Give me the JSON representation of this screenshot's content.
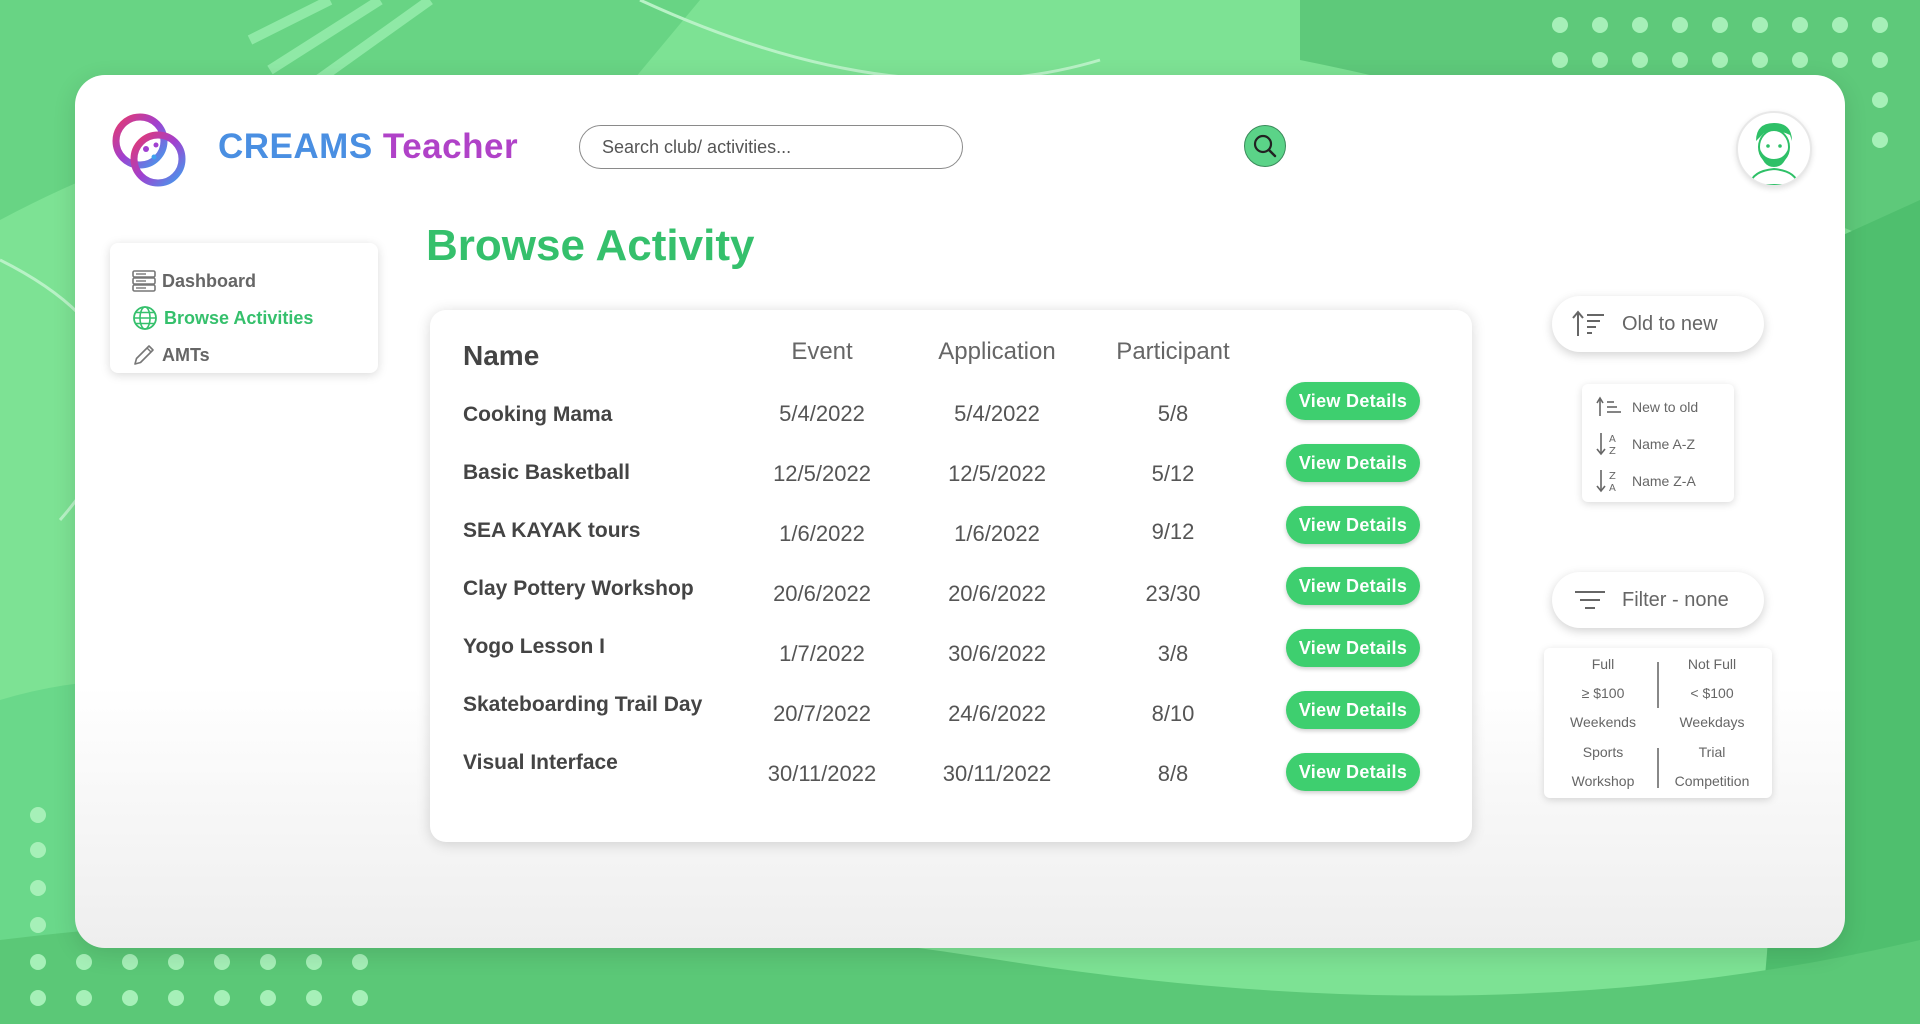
{
  "app": {
    "brand_part1": "CREAMS",
    "brand_part2": "Teacher"
  },
  "search": {
    "placeholder": "Search club/ activities..."
  },
  "sidebar": {
    "items": [
      {
        "label": "Dashboard",
        "icon": "server-icon",
        "active": false
      },
      {
        "label": "Browse Activities",
        "icon": "globe-icon",
        "active": true
      },
      {
        "label": "AMTs",
        "icon": "pencil-icon",
        "active": false
      }
    ]
  },
  "page": {
    "title": "Browse Activity"
  },
  "table": {
    "headers": {
      "name": "Name",
      "event": "Event",
      "application": "Application",
      "participant": "Participant"
    },
    "button_label": "View Details",
    "rows": [
      {
        "name": "Cooking Mama",
        "event": "5/4/2022",
        "application": "5/4/2022",
        "participant": "5/8"
      },
      {
        "name": "Basic Basketball",
        "event": "12/5/2022",
        "application": "12/5/2022",
        "participant": "5/12"
      },
      {
        "name": "SEA KAYAK tours",
        "event": "1/6/2022",
        "application": "1/6/2022",
        "participant": "9/12"
      },
      {
        "name": "Clay Pottery Workshop",
        "event": "20/6/2022",
        "application": "20/6/2022",
        "participant": "23/30"
      },
      {
        "name": "Yogo Lesson I",
        "event": "1/7/2022",
        "application": "30/6/2022",
        "participant": "3/8"
      },
      {
        "name": "Skateboarding Trail Day",
        "event": "20/7/2022",
        "application": "24/6/2022",
        "participant": "8/10"
      },
      {
        "name": "Visual Interface",
        "event": "30/11/2022",
        "application": "30/11/2022",
        "participant": "8/8"
      }
    ]
  },
  "sort": {
    "current": "Old to new",
    "options": [
      "New to old",
      "Name A-Z",
      "Name Z-A"
    ]
  },
  "filter": {
    "current": "Filter - none",
    "left_options": [
      "Full",
      "≥ $100",
      "Weekends",
      "Sports",
      "Workshop"
    ],
    "right_options": [
      "Not Full",
      "< $100",
      "Weekdays",
      "Trial",
      "Competition"
    ]
  },
  "colors": {
    "accent": "#35c06c",
    "button": "#3ecf6f",
    "background": "#7de294",
    "brand_blue": "#4a8fe2",
    "brand_purple": "#b042c8"
  }
}
